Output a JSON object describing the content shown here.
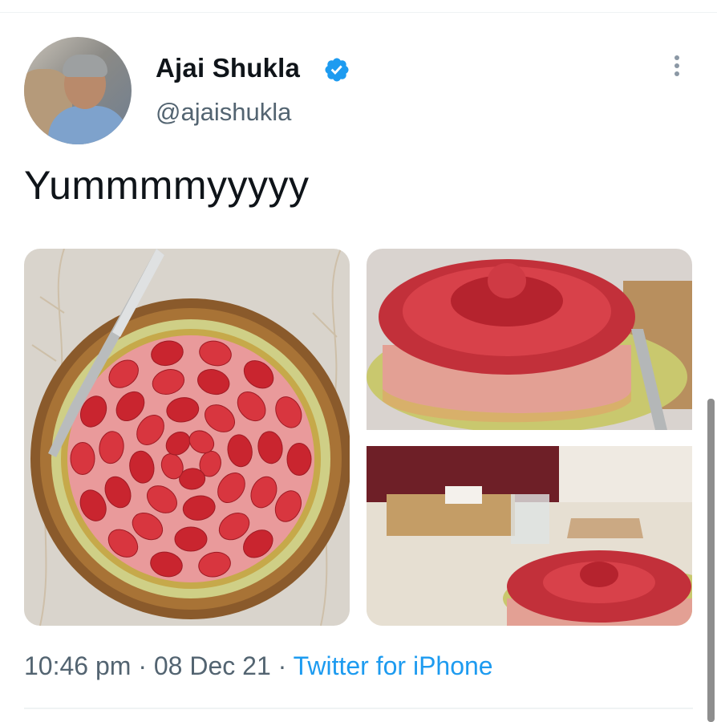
{
  "tweet": {
    "author_name": "Ajai Shukla",
    "author_handle": "@ajaishukla",
    "text": "Yummmmyyyyy",
    "time": "10:46 pm",
    "date": "08 Dec 21",
    "separator": "·",
    "source": "Twitter for iPhone"
  },
  "colors": {
    "verified_badge": "#1d9bf0",
    "link": "#1d9bf0",
    "secondary_text": "#536471",
    "primary_text": "#0f1419"
  },
  "icons": {
    "verified": "verified-badge-icon",
    "more": "more-vertical-icon"
  }
}
